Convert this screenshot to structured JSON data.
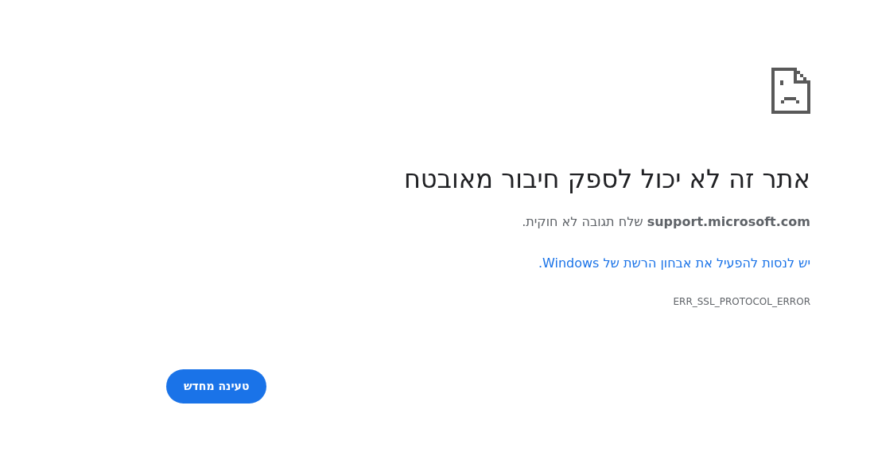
{
  "error_page": {
    "title": "אתר זה לא יכול לספק חיבור מאובטח",
    "message": "**support.microsoft.com** שלח תגובה לא חוקית.",
    "diagnostics_link": "יש לנסות להפעיל את אבחון הרשת של Windows.",
    "error_code": "ERR_SSL_PROTOCOL_ERROR",
    "reload_button": "טעינה מחדש"
  }
}
